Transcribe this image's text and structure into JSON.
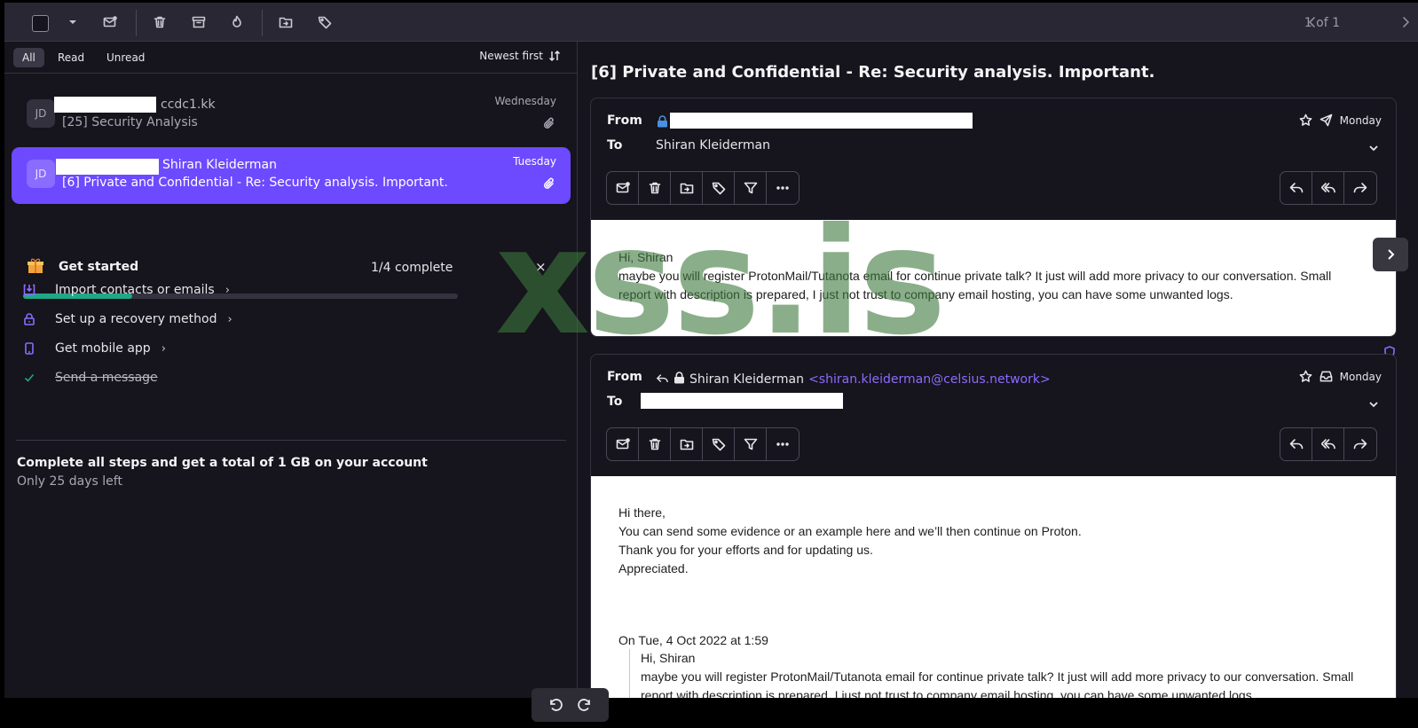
{
  "toolbar": {
    "pagination": "1 of 1"
  },
  "filters": {
    "all": "All",
    "read": "Read",
    "unread": "Unread",
    "sort": "Newest first"
  },
  "messages": [
    {
      "avatar": "JD",
      "sender": "ccdc1.kk",
      "subject": "[25] Security Analysis",
      "date": "Wednesday"
    },
    {
      "avatar": "JD",
      "sender": "Shiran Kleiderman",
      "subject": "[6] Private and Confidential - Re: Security analysis. Important.",
      "date": "Tuesday"
    }
  ],
  "get_started": {
    "title": "Get started",
    "count": "1/4 complete",
    "close": "×",
    "progress": 0.25,
    "steps": [
      {
        "label": "Import contacts or emails",
        "icon": "import-icon",
        "done": false
      },
      {
        "label": "Set up a recovery method",
        "icon": "lock-icon",
        "done": false
      },
      {
        "label": "Get mobile app",
        "icon": "mobile-icon",
        "done": false
      },
      {
        "label": "Send a message",
        "icon": "check-icon",
        "done": true
      }
    ],
    "promo_title": "Complete all steps and get a total of 1 GB on your account",
    "promo_sub": "Only 25 days left"
  },
  "thread": {
    "title": "[6] Private and Confidential - Re: Security analysis. Important.",
    "msg1": {
      "from_label": "From",
      "to_label": "To",
      "to": "Shiran Kleiderman",
      "date": "Monday",
      "body": [
        "Hi, Shiran",
        "maybe you will register ProtonMail/Tutanota email for continue private talk? It just will add more privacy to our conversation. Small",
        "report with description is prepared, I just not trust to company email hosting, you can have some unwanted logs."
      ]
    },
    "msg2": {
      "from_label": "From",
      "to_label": "To",
      "from_name": "Shiran Kleiderman",
      "from_addr": "<shiran.kleiderman@celsius.network>",
      "date": "Monday",
      "body": [
        "Hi there,",
        "You can send some evidence or an example here and we’ll then continue on Proton.",
        "Thank you for your efforts and for updating us.",
        "Appreciated."
      ],
      "quote_header": "On Tue, 4 Oct 2022 at 1:59",
      "quote": [
        "Hi, Shiran",
        "maybe you will register ProtonMail/Tutanota email for continue private talk? It just will add more privacy to our conversation. Small",
        "report with description is prepared, I just not trust to company email hosting, you can have some unwanted logs."
      ]
    }
  },
  "watermark": "xss.is"
}
